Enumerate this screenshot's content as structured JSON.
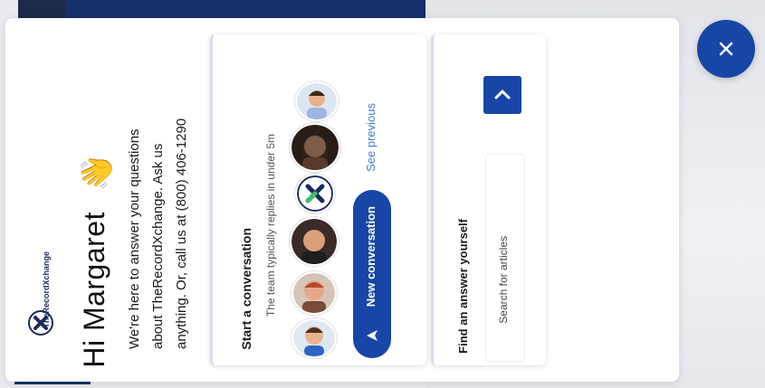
{
  "brand": {
    "logo_text": "TheRecordXchange",
    "accent_color": "#1746a7",
    "link_color": "#3d7be0"
  },
  "home": {
    "greeting": "Hi Margaret",
    "wave_emoji": "👋",
    "intro_lines": [
      "We're here to answer your questions",
      "about TheRecordXchange. Ask us",
      "anything. Or, call us at (800) 406-1290"
    ]
  },
  "conversation": {
    "title": "Start a conversation",
    "subtitle": "The team typically replies in under 5m",
    "new_button_label": "New conversation",
    "see_previous_label": "See previous"
  },
  "search": {
    "title": "Find an answer yourself",
    "placeholder": "Search for articles"
  },
  "icons": {
    "close": "close-icon",
    "send_arrow": "arrow-icon",
    "search_chevron": "chevron-up-icon"
  }
}
